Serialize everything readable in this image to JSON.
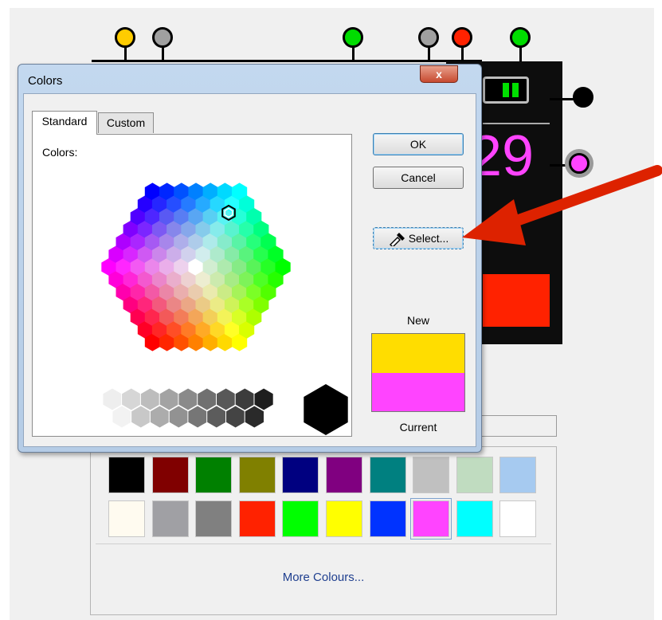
{
  "dialog": {
    "title": "Colors",
    "close_glyph": "x",
    "tabs": [
      {
        "label": "Standard",
        "active": true
      },
      {
        "label": "Custom",
        "active": false
      }
    ],
    "colors_label": "Colors:",
    "ok_label": "OK",
    "cancel_label": "Cancel",
    "select_label": "Select...",
    "select_icon": "eyedropper-icon",
    "new_label": "New",
    "current_label": "Current",
    "new_color": "#ffdd00",
    "current_color": "#ff44ff"
  },
  "device": {
    "digits": "29",
    "digit_color": "#ff44ff"
  },
  "palette": {
    "rows": [
      [
        "#000000",
        "#800000",
        "#008000",
        "#808000",
        "#000080",
        "#800080",
        "#008080",
        "#c0c0c0",
        "#c0dcc0",
        "#a6caf0"
      ],
      [
        "#fffbf0",
        "#a0a0a4",
        "#808080",
        "#ff2200",
        "#00ff00",
        "#ffff00",
        "#0033ff",
        "#ff44ff",
        "#00ffff",
        "#ffffff"
      ]
    ],
    "selected": "#ff44ff",
    "more_label": "More Colours..."
  },
  "connectors": {
    "top": [
      "#ffcc00",
      "#a0a0a0",
      "#00dd00",
      "#a0a0a0",
      "#ff2200",
      "#00dd00"
    ],
    "right": [
      "#000000",
      "#ff44ff"
    ]
  },
  "accent": {
    "arrow": "#dd2200"
  }
}
